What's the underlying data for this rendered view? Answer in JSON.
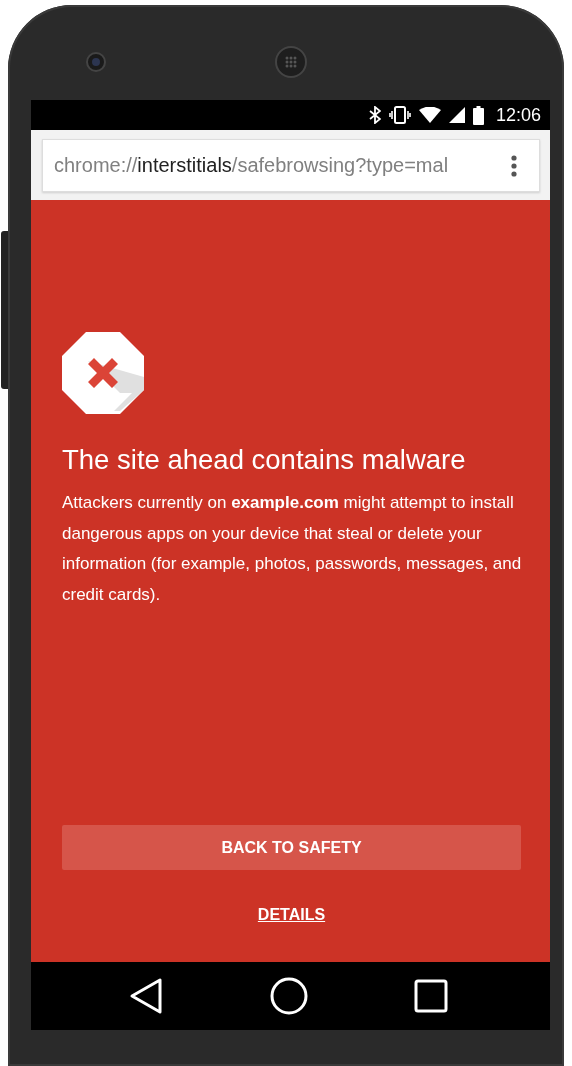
{
  "status_bar": {
    "time": "12:06"
  },
  "address_bar": {
    "url": "chrome://**interstitials**/safebrowsing?type=mal"
  },
  "page": {
    "title": "The site ahead contains malware",
    "body": "Attackers currently on **example.com** might attempt to install dangerous apps on your device that steal or delete your information (for example, photos, passwords, messages, and credit cards).",
    "primary_button": "BACK TO SAFETY",
    "link": "DETAILS"
  }
}
